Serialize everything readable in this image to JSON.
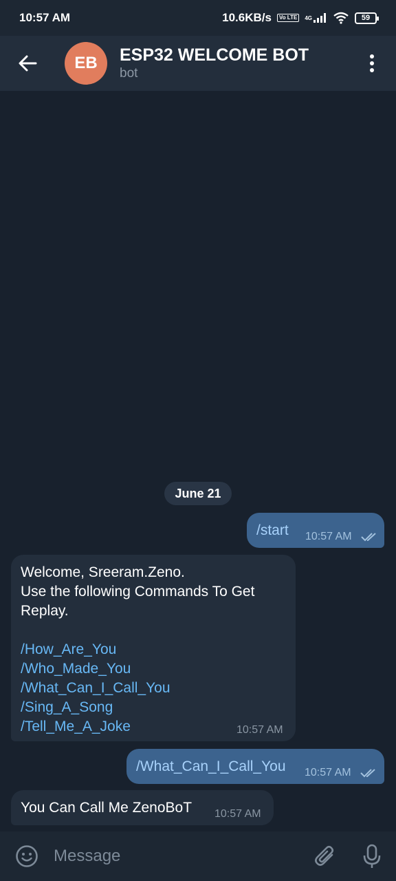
{
  "status_bar": {
    "time": "10:57 AM",
    "net_speed": "10.6KB/s",
    "volte": "Vo LTE",
    "network": "4G",
    "battery": "59"
  },
  "header": {
    "avatar_initials": "EB",
    "avatar_color": "#e17d5d",
    "title": "ESP32 WELCOME BOT",
    "subtitle": "bot"
  },
  "chat": {
    "date_chip": "June 21",
    "messages": [
      {
        "direction": "out",
        "text": "/start",
        "time": "10:57 AM",
        "read": true
      },
      {
        "direction": "in",
        "lines": [
          "Welcome, Sreeram.Zeno.",
          "Use the following Commands To Get",
          "Replay."
        ],
        "commands": [
          "/How_Are_You",
          "/Who_Made_You",
          "/What_Can_I_Call_You",
          "/Sing_A_Song",
          "/Tell_Me_A_Joke"
        ],
        "time": "10:57 AM"
      },
      {
        "direction": "out",
        "text": "/What_Can_I_Call_You",
        "time": "10:57 AM",
        "read": true
      },
      {
        "direction": "in",
        "text": "You Can Call Me ZenoBoT",
        "time": "10:57 AM"
      }
    ]
  },
  "composer": {
    "placeholder": "Message"
  },
  "colors": {
    "background": "#18212d",
    "header": "#232e3c",
    "outgoing_bubble": "#3c638e",
    "incoming_bubble": "#232e3c",
    "link": "#68b8f5"
  },
  "icons": {
    "back": "arrow-left-icon",
    "menu": "more-vertical-icon",
    "emoji": "smiley-icon",
    "attach": "paperclip-icon",
    "mic": "microphone-icon",
    "read": "double-check-icon"
  }
}
